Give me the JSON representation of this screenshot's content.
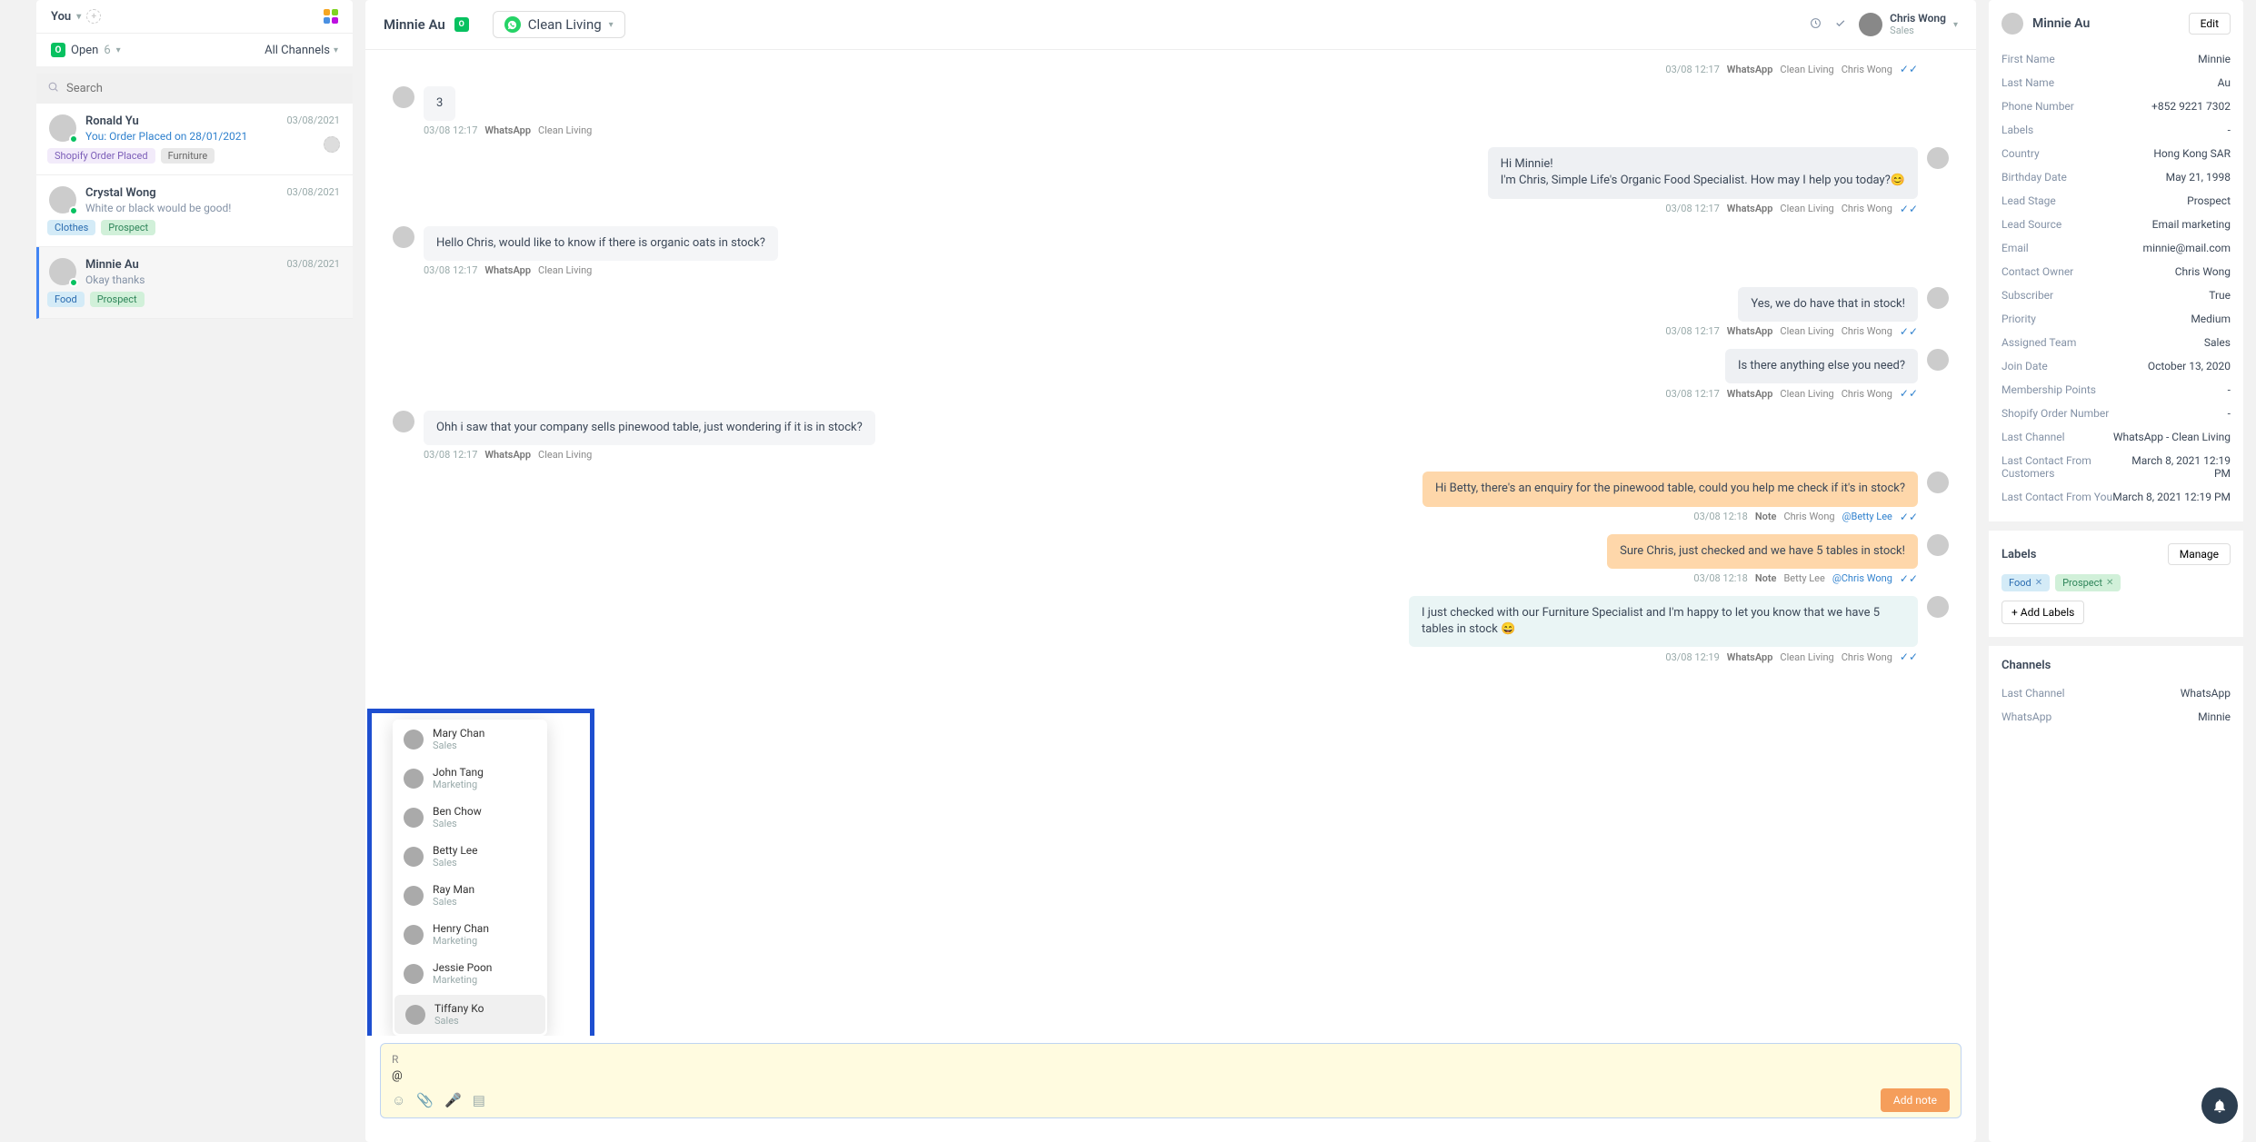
{
  "sidebar": {
    "you_label": "You",
    "open_label": "Open",
    "open_count": "6",
    "channels_label": "All Channels",
    "search_placeholder": "Search",
    "conversations": [
      {
        "name": "Ronald Yu",
        "date": "03/08/2021",
        "snippet": "You: Order Placed on 28/01/2021",
        "snippet_blue": true,
        "tags": [
          {
            "txt": "Shopify Order Placed",
            "cls": "tag-purple"
          },
          {
            "txt": "Furniture",
            "cls": "tag-gray"
          }
        ],
        "assignee_empty": true
      },
      {
        "name": "Crystal Wong",
        "date": "03/08/2021",
        "snippet": "White or black would be good!",
        "tags": [
          {
            "txt": "Clothes",
            "cls": "tag-blue"
          },
          {
            "txt": "Prospect",
            "cls": "tag-green"
          }
        ]
      },
      {
        "name": "Minnie Au",
        "date": "03/08/2021",
        "snippet": "Okay thanks",
        "tags": [
          {
            "txt": "Food",
            "cls": "tag-blue"
          },
          {
            "txt": "Prospect",
            "cls": "tag-green"
          }
        ],
        "active": true
      }
    ]
  },
  "chat": {
    "title": "Minnie Au",
    "channel": "Clean Living",
    "assignee": {
      "name": "Chris Wong",
      "role": "Sales"
    },
    "messages": [
      {
        "type": "meta-right",
        "time": "03/08 12:17",
        "bold": "WhatsApp",
        "ch": "Clean Living",
        "who": "Chris Wong",
        "checks": true
      },
      {
        "type": "in",
        "text": "3",
        "time": "03/08 12:17",
        "bold": "WhatsApp",
        "ch": "Clean Living"
      },
      {
        "type": "out",
        "bubble": "out-gray",
        "text": "Hi Minnie!\nI'm Chris, Simple Life's Organic Food Specialist. How may I help you today?😊",
        "time": "03/08 12:17",
        "bold": "WhatsApp",
        "ch": "Clean Living",
        "who": "Chris Wong",
        "checks": true
      },
      {
        "type": "in",
        "text": "Hello Chris, would like to know if there is organic oats in stock?",
        "time": "03/08 12:17",
        "bold": "WhatsApp",
        "ch": "Clean Living"
      },
      {
        "type": "out",
        "bubble": "out-gray",
        "text": "Yes, we do have that in stock!",
        "time": "03/08 12:17",
        "bold": "WhatsApp",
        "ch": "Clean Living",
        "who": "Chris Wong",
        "checks": true
      },
      {
        "type": "out",
        "bubble": "out-gray",
        "text": "Is there anything else you need?",
        "time": "03/08 12:17",
        "bold": "WhatsApp",
        "ch": "Clean Living",
        "who": "Chris Wong",
        "checks": true
      },
      {
        "type": "in",
        "text": "Ohh i saw that your company sells pinewood table, just wondering if it is in stock?",
        "time": "03/08 12:17",
        "bold": "WhatsApp",
        "ch": "Clean Living"
      },
      {
        "type": "out",
        "bubble": "out-orange",
        "text": "Hi Betty, there's an enquiry for the pinewood table, could you help me check if it's in stock?",
        "time": "03/08 12:18",
        "bold": "Note",
        "who": "Chris Wong",
        "mention": "@Betty Lee",
        "checks": true
      },
      {
        "type": "out",
        "bubble": "out-orange",
        "text": "Sure Chris, just checked and we have 5 tables in stock!",
        "av_alt": true,
        "time": "03/08 12:18",
        "bold": "Note",
        "who": "Betty Lee",
        "mention": "@Chris Wong",
        "checks": true
      },
      {
        "type": "out",
        "bubble": "out-teal",
        "text": "I just checked with our Furniture Specialist and I'm happy to let you know that we have 5 tables in stock 😄",
        "time": "03/08 12:19",
        "bold": "WhatsApp",
        "ch": "Clean Living",
        "who": "Chris Wong",
        "checks": true
      }
    ],
    "mentions": [
      {
        "name": "Mary Chan",
        "role": "Sales"
      },
      {
        "name": "John Tang",
        "role": "Marketing"
      },
      {
        "name": "Ben Chow",
        "role": "Sales"
      },
      {
        "name": "Betty Lee",
        "role": "Sales"
      },
      {
        "name": "Ray Man",
        "role": "Sales"
      },
      {
        "name": "Henry Chan",
        "role": "Marketing"
      },
      {
        "name": "Jessie Poon",
        "role": "Marketing"
      },
      {
        "name": "Tiffany Ko",
        "role": "Sales",
        "hover": true
      }
    ],
    "composer": {
      "reply_label": "R",
      "input": "@",
      "add_note": "Add note"
    }
  },
  "panel": {
    "name": "Minnie Au",
    "edit": "Edit",
    "fields": [
      {
        "k": "First Name",
        "v": "Minnie"
      },
      {
        "k": "Last Name",
        "v": "Au"
      },
      {
        "k": "Phone Number",
        "v": "+852 9221 7302"
      },
      {
        "k": "Labels",
        "v": "-"
      },
      {
        "k": "Country",
        "v": "Hong Kong SAR"
      },
      {
        "k": "Birthday Date",
        "v": "May 21, 1998"
      },
      {
        "k": "Lead Stage",
        "v": "Prospect"
      },
      {
        "k": "Lead Source",
        "v": "Email marketing"
      },
      {
        "k": "Email",
        "v": "minnie@mail.com"
      },
      {
        "k": "Contact Owner",
        "v": "Chris Wong"
      },
      {
        "k": "Subscriber",
        "v": "True"
      },
      {
        "k": "Priority",
        "v": "Medium"
      },
      {
        "k": "Assigned Team",
        "v": "Sales"
      },
      {
        "k": "Join Date",
        "v": "October 13, 2020"
      },
      {
        "k": "Membership Points",
        "v": "-"
      },
      {
        "k": "Shopify Order Number",
        "v": "-"
      },
      {
        "k": "Last Channel",
        "v": "WhatsApp - Clean Living"
      },
      {
        "k": "Last Contact From Customers",
        "v": "March 8, 2021 12:19 PM"
      },
      {
        "k": "Last Contact From You",
        "v": "March 8, 2021 12:19 PM"
      }
    ],
    "labels": {
      "title": "Labels",
      "manage": "Manage",
      "add": "+ Add Labels",
      "chips": [
        {
          "txt": "Food",
          "cls": "chip-blue"
        },
        {
          "txt": "Prospect",
          "cls": "chip-green"
        }
      ]
    },
    "channels": {
      "title": "Channels",
      "rows": [
        {
          "k": "Last Channel",
          "v": "WhatsApp"
        },
        {
          "k": "WhatsApp",
          "v": "Minnie"
        }
      ]
    }
  }
}
